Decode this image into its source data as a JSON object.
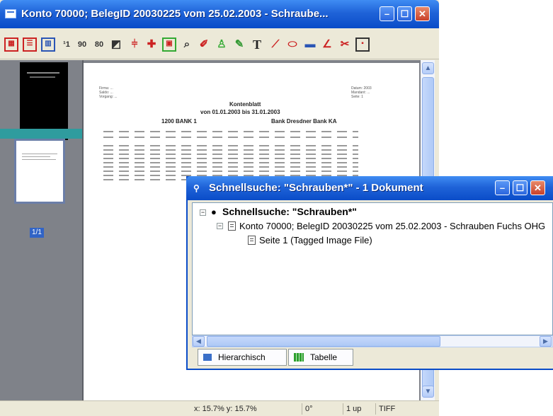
{
  "main_window": {
    "title": "Konto 70000; BelegID 20030225 vom 25.02.2003 - Schraube...",
    "buttons": {
      "minimize": "–",
      "maximize": "☐",
      "close": "✕"
    }
  },
  "toolbar": {
    "icons": [
      "grid-icon",
      "split-h-icon",
      "split-v-icon",
      "page1-icon",
      "page90-icon",
      "page80-icon",
      "crop-icon",
      "split-line-icon",
      "split-marker-icon",
      "frame-icon",
      "zoom-icon",
      "pick-icon",
      "stamp-icon",
      "highlighter-icon",
      "text-icon",
      "pen-icon",
      "lasso-icon",
      "marker-box-icon",
      "angle-icon",
      "cut-icon",
      "export-icon"
    ],
    "glyphs": {
      "page1": "¹1",
      "page90": "90",
      "page80": "80",
      "text": "T"
    }
  },
  "thumbnails": {
    "label": "1/1"
  },
  "document": {
    "header_left": [
      "Firma: ...",
      "Saldo: ...",
      "Vorgang: ..."
    ],
    "header_right": [
      "Datum: 2003",
      "Mandant: ...",
      "Seite: 1"
    ],
    "title": "Kontenblatt",
    "period": "von 01.01.2003 bis 31.01.2003",
    "account": "1200  BANK 1",
    "bank": "Bank Dresdner Bank KA"
  },
  "status_bar": {
    "coords": "x: 15.7%  y: 15.7%",
    "rotation": "0°",
    "layout": "1 up",
    "format": "TIFF"
  },
  "search_window": {
    "title": "Schnellsuche: \"Schrauben*\" - 1 Dokument",
    "tree": {
      "root": "Schnellsuche: \"Schrauben*\"",
      "document": "Konto 70000; BelegID 20030225 vom 25.02.2003 - Schrauben Fuchs OHG",
      "page": "Seite 1 (Tagged Image File)"
    },
    "tabs": {
      "hierarchical": "Hierarchisch",
      "table": "Tabelle"
    }
  },
  "colors": {
    "title_blue": "#1f63d8",
    "chrome": "#ece9d8",
    "dark_panel": "#7f8289",
    "teal": "#2f9c9e"
  }
}
